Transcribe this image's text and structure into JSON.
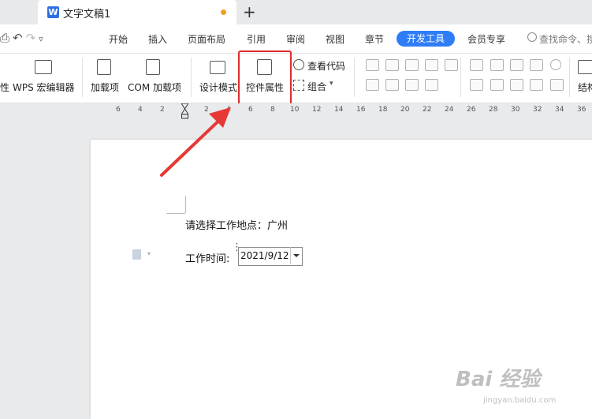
{
  "tab": {
    "title": "文字文稿1",
    "app_icon": "W"
  },
  "menubar": {
    "items": [
      "开始",
      "插入",
      "页面布局",
      "引用",
      "审阅",
      "视图",
      "章节"
    ],
    "active": "开发工具",
    "member": "会员专享",
    "search_label": "查找命令、搜"
  },
  "ribbon": {
    "partial_left": "性",
    "macro_editor": "WPS 宏编辑器",
    "addins": "加载项",
    "com_addins": "COM 加载项",
    "design_mode": "设计模式",
    "control_properties": "控件属性",
    "view_code": "查看代码",
    "group": "组合",
    "partial_right": "结构"
  },
  "ruler": {
    "numbers": [
      "6",
      "4",
      "2",
      "2",
      "4",
      "6",
      "8",
      "10",
      "12",
      "14",
      "16",
      "18",
      "20",
      "22",
      "24",
      "26",
      "28",
      "30",
      "32",
      "34",
      "36"
    ]
  },
  "document": {
    "line1": "请选择工作地点：广州",
    "time_label": "工作时间:",
    "date_value": "2021/9/12"
  },
  "watermark": {
    "main": "Bai 经验",
    "sub": "jingyan.baidu.com"
  },
  "colors": {
    "accent": "#2f7df6",
    "highlight": "#e02b2b",
    "arrow": "#e53935"
  }
}
